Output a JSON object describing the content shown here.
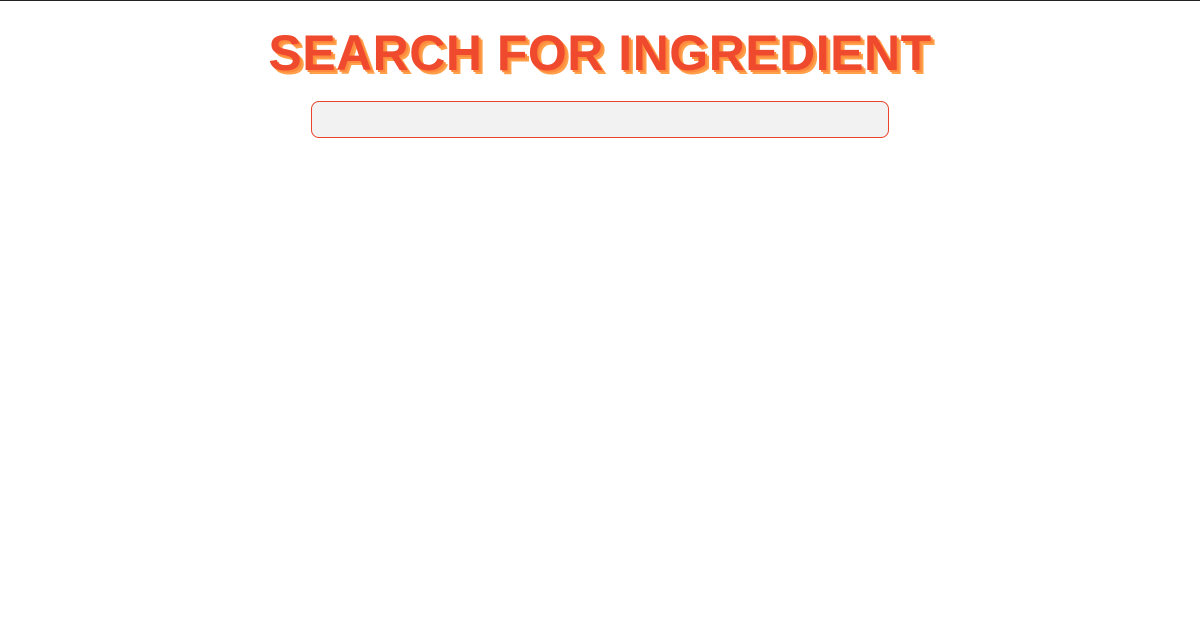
{
  "header": {
    "title": "SEARCH FOR INGREDIENT"
  },
  "search": {
    "value": "",
    "placeholder": ""
  },
  "colors": {
    "title": "#ef4a2d",
    "title_shadow_1": "#ff8a3d",
    "title_shadow_2": "#ffa04a",
    "input_border": "#e8442a",
    "input_background": "#f2f2f2"
  }
}
